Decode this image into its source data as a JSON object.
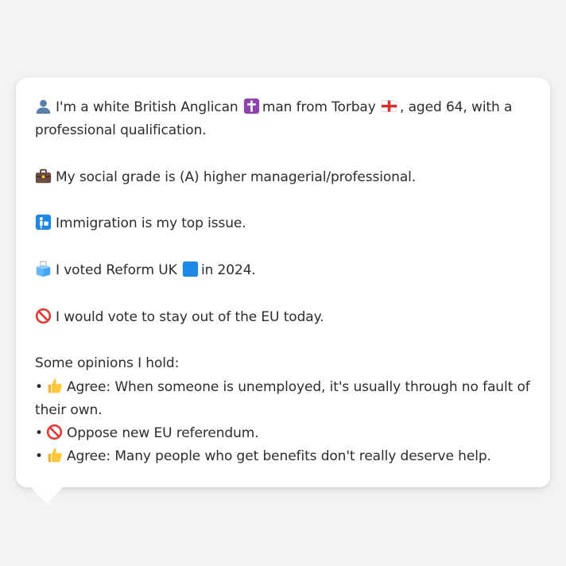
{
  "profile": {
    "line1_a": "I'm a white British Anglican",
    "line1_b": "man from Torbay",
    "line1_c": ", aged 64, with a professional qualification.",
    "line2": "My social grade is (A) higher managerial/professional.",
    "line3": "Immigration is my top issue.",
    "line4_a": "I voted Reform UK",
    "line4_b": "in 2024.",
    "line5": "I would vote to stay out of the EU today."
  },
  "opinions": {
    "heading": "Some opinions I hold:",
    "bullet": "•",
    "items": [
      {
        "text": "Agree: When someone is unemployed, it's usually through no fault of their own.",
        "icon": "thumbs-up-icon"
      },
      {
        "text": "Oppose new EU referendum.",
        "icon": "no-entry-icon"
      },
      {
        "text": "Agree: Many people who get benefits don't really deserve help.",
        "icon": "thumbs-up-icon"
      }
    ]
  },
  "colors": {
    "background": "#f2f3f5",
    "bubble": "#ffffff",
    "text": "#2a2c30",
    "reform_blue": "#1e88e5",
    "prohibited_red": "#e53935",
    "cross_purple": "#8e44ad"
  }
}
